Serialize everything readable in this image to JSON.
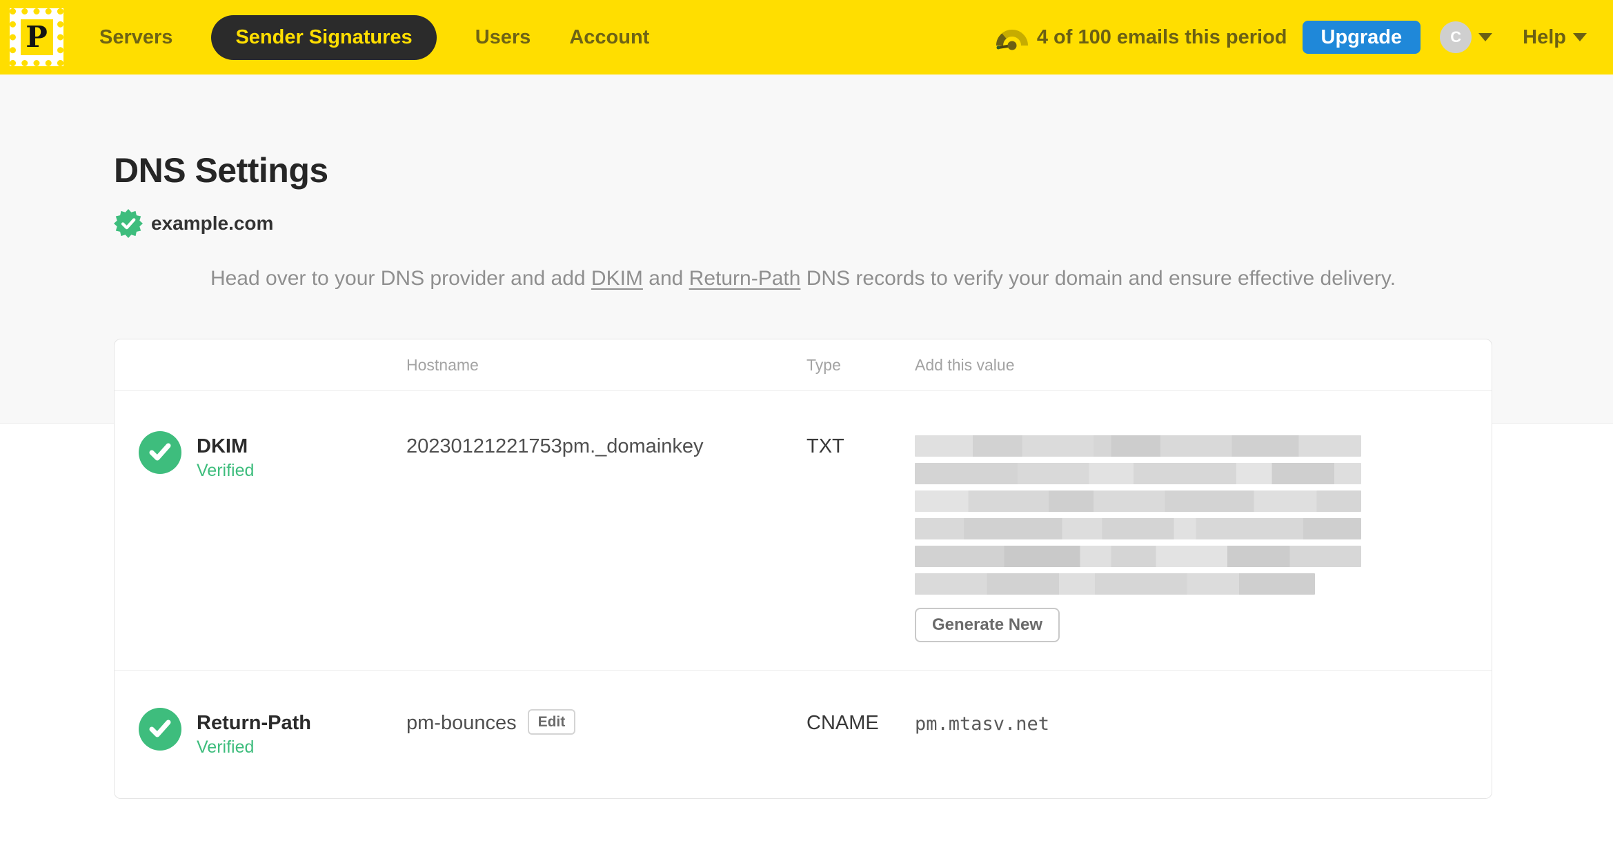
{
  "nav": {
    "brand_letter": "P",
    "items": [
      {
        "label": "Servers",
        "active": false
      },
      {
        "label": "Sender Signatures",
        "active": true
      },
      {
        "label": "Users",
        "active": false
      },
      {
        "label": "Account",
        "active": false
      }
    ],
    "usage_text": "4 of 100 emails this period",
    "upgrade_label": "Upgrade",
    "avatar_letter": "C",
    "help_label": "Help"
  },
  "page": {
    "title": "DNS Settings",
    "domain": "example.com",
    "intro": {
      "part1": "Head over to your DNS provider and add ",
      "link1": "DKIM",
      "part2": " and ",
      "link2": "Return-Path",
      "part3": " DNS records to verify your domain and ensure effective delivery."
    }
  },
  "table": {
    "headers": {
      "hostname": "Hostname",
      "type": "Type",
      "value": "Add this value"
    },
    "rows": [
      {
        "name": "DKIM",
        "status": "Verified",
        "hostname": "20230121221753pm._domainkey",
        "type": "TXT",
        "value_redacted_lines": 6,
        "action_label": "Generate New"
      },
      {
        "name": "Return-Path",
        "status": "Verified",
        "hostname": "pm-bounces",
        "edit_label": "Edit",
        "type": "CNAME",
        "value": "pm.mtasv.net"
      }
    ]
  },
  "colors": {
    "brand_yellow": "#FFDE00",
    "upgrade_blue": "#1F88D9",
    "verified_green": "#3EBD7D",
    "nav_text_olive": "#6b6014"
  }
}
